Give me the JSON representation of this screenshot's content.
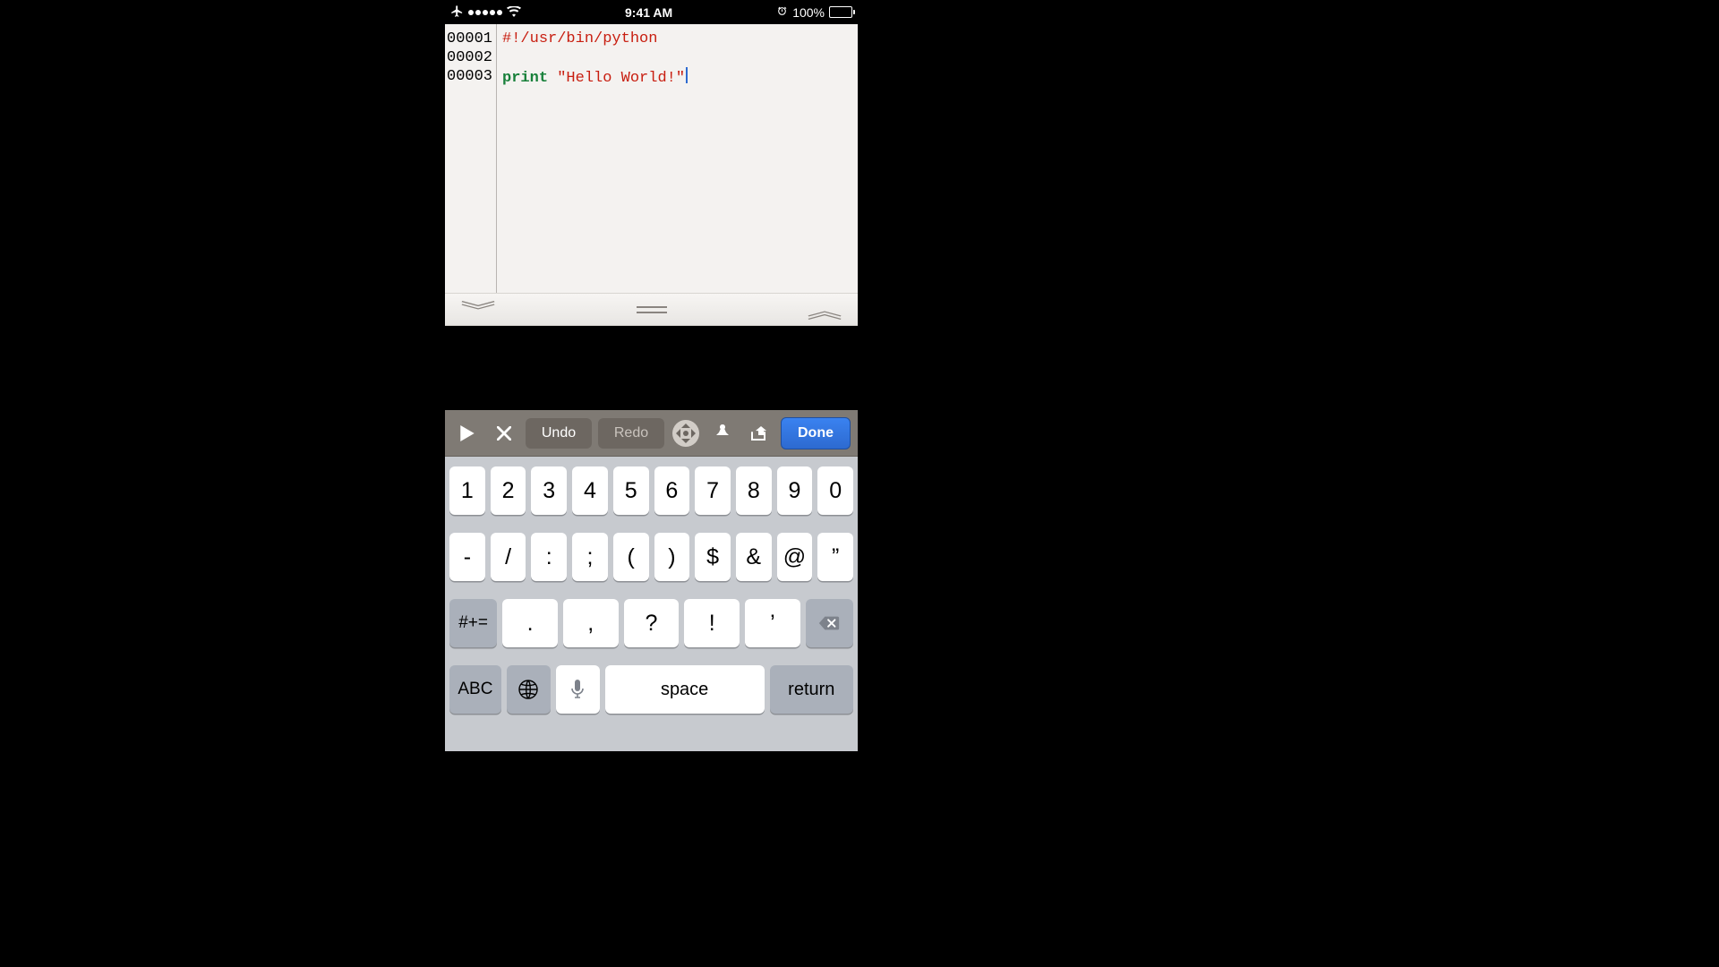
{
  "status": {
    "time": "9:41 AM",
    "battery_pct": "100%"
  },
  "code": {
    "lines": [
      "00001",
      "00002",
      "00003"
    ],
    "shebang": "#!/usr/bin/python",
    "kw_print": "print",
    "string_literal": "\"Hello World!\""
  },
  "toolbar": {
    "undo": "Undo",
    "redo": "Redo",
    "done": "Done"
  },
  "keyboard": {
    "row1": [
      "1",
      "2",
      "3",
      "4",
      "5",
      "6",
      "7",
      "8",
      "9",
      "0"
    ],
    "row2": [
      "-",
      "/",
      ":",
      ";",
      "(",
      ")",
      "$",
      "&",
      "@",
      "”"
    ],
    "row3_special_left": "#+=",
    "row3": [
      ".",
      ",",
      "?",
      "!",
      "’"
    ],
    "row4_abc": "ABC",
    "row4_space": "space",
    "row4_return": "return"
  }
}
